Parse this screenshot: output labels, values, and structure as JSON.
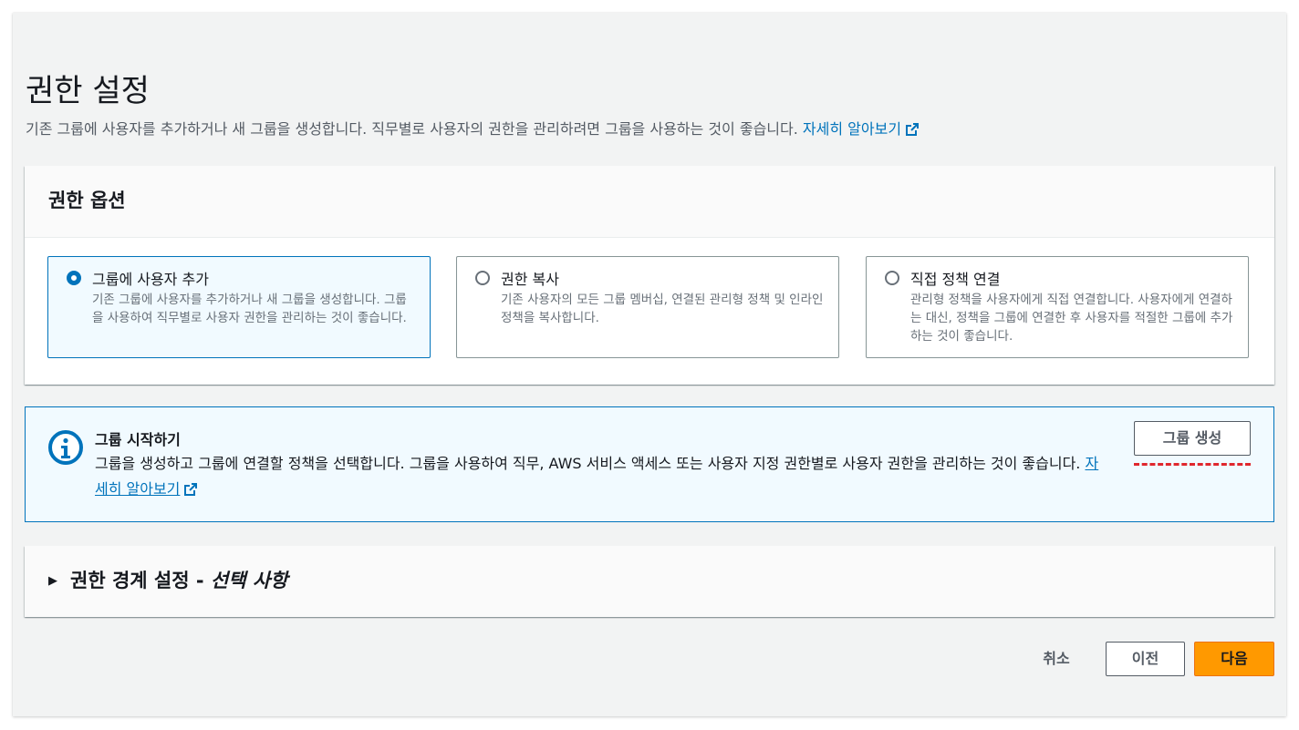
{
  "page": {
    "title": "권한 설정",
    "description": "기존 그룹에 사용자를 추가하거나 새 그룹을 생성합니다. 직무별로 사용자의 권한을 관리하려면 그룹을 사용하는 것이 좋습니다.",
    "learn_more": "자세히 알아보기"
  },
  "options": {
    "header": "권한 옵션",
    "tiles": [
      {
        "title": "그룹에 사용자 추가",
        "description": "기존 그룹에 사용자를 추가하거나 새 그룹을 생성합니다. 그룹을 사용하여 직무별로 사용자 권한을 관리하는 것이 좋습니다.",
        "selected": true
      },
      {
        "title": "권한 복사",
        "description": "기존 사용자의 모든 그룹 멤버십, 연결된 관리형 정책 및 인라인 정책을 복사합니다.",
        "selected": false
      },
      {
        "title": "직접 정책 연결",
        "description": "관리형 정책을 사용자에게 직접 연결합니다. 사용자에게 연결하는 대신, 정책을 그룹에 연결한 후 사용자를 적절한 그룹에 추가하는 것이 좋습니다.",
        "selected": false
      }
    ]
  },
  "alert": {
    "title": "그룹 시작하기",
    "body": "그룹을 생성하고 그룹에 연결할 정책을 선택합니다. 그룹을 사용하여 직무, AWS 서비스 액세스 또는 사용자 지정 권한별로 사용자 권한을 관리하는 것이 좋습니다.",
    "learn_more": "자세히 알아보기",
    "create_button": "그룹 생성"
  },
  "boundary": {
    "title": "권한 경계 설정 - ",
    "optional": "선택 사항"
  },
  "footer": {
    "cancel": "취소",
    "previous": "이전",
    "next": "다음"
  },
  "colors": {
    "accent": "#0073bb",
    "primary_button": "#ff9900",
    "highlight": "#e0262d"
  }
}
